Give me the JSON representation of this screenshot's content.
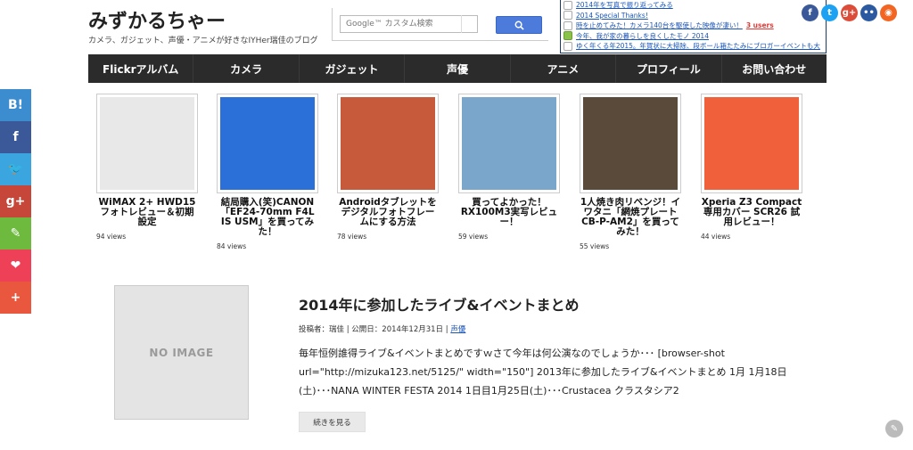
{
  "site": {
    "title": "みずかるちゃー",
    "description": "カメラ、ガジェット、声優・アニメが好きなIYHer瑞佳のブログ"
  },
  "search": {
    "placeholder": "Google™ カスタム検索"
  },
  "hatena": {
    "items": [
      {
        "text": "2014年を写真で振り返ってみる",
        "users": ""
      },
      {
        "text": "2014 Special Thanks!",
        "users": ""
      },
      {
        "text": "時を止めてみた！カメラ140台を駆使した映像が凄い！",
        "users": "3 users"
      },
      {
        "text": "今年、我が家の暮らしを良くしたモノ 2014",
        "users": ""
      },
      {
        "text": "ゆく年くる年2015。年賀状に大掃除、段ボール箱たたみにブロガーイベントも大",
        "users": ""
      }
    ]
  },
  "social_top": [
    {
      "icon": "facebook-icon",
      "glyph": "f",
      "color": "#3b5998"
    },
    {
      "icon": "twitter-icon",
      "glyph": "t",
      "color": "#1da1f2"
    },
    {
      "icon": "googleplus-icon",
      "glyph": "g+",
      "color": "#dd4b39"
    },
    {
      "icon": "flickr-icon",
      "glyph": "••",
      "color": "#2c5aa0"
    },
    {
      "icon": "rss-icon",
      "glyph": "◉",
      "color": "#f26522"
    }
  ],
  "nav": [
    "Flickrアルバム",
    "カメラ",
    "ガジェット",
    "声優",
    "アニメ",
    "プロフィール",
    "お問い合わせ"
  ],
  "share_bar": [
    {
      "icon": "hatena-bookmark-icon",
      "glyph": "B!",
      "color": "#3c8cd0"
    },
    {
      "icon": "facebook-icon",
      "glyph": "f",
      "color": "#3b5998"
    },
    {
      "icon": "twitter-icon",
      "glyph": "🐦",
      "color": "#3ba5e0"
    },
    {
      "icon": "googleplus-icon",
      "glyph": "g+",
      "color": "#c6473a"
    },
    {
      "icon": "evernote-icon",
      "glyph": "✎",
      "color": "#6dba3f"
    },
    {
      "icon": "pocket-icon",
      "glyph": "❤",
      "color": "#ee4056"
    },
    {
      "icon": "more-share-icon",
      "glyph": "+",
      "color": "#e9573f"
    }
  ],
  "popular": [
    {
      "title": "WiMAX 2+ HWD15 フォトレビュー＆初期設定",
      "views": "94 views",
      "thumb_color": "#e8e8e8"
    },
    {
      "title": "結局購入(笑)CANON「EF24-70mm F4L IS USM」を買ってみた！",
      "views": "84 views",
      "thumb_color": "#2b6fd8"
    },
    {
      "title": "Androidタブレットをデジタルフォトフレームにする方法",
      "views": "78 views",
      "thumb_color": "#c65a3a"
    },
    {
      "title": "買ってよかった！RX100M3実写レビュー！",
      "views": "59 views",
      "thumb_color": "#7aa6cc"
    },
    {
      "title": "1人焼き肉リベンジ！イワタニ「網焼プレート CB-P-AM2」を買ってみた！",
      "views": "55 views",
      "thumb_color": "#5a4a3a"
    },
    {
      "title": "Xperia Z3 Compact専用カバー SCR26 試用レビュー！",
      "views": "44 views",
      "thumb_color": "#f0603a"
    }
  ],
  "article": {
    "no_image": "NO IMAGE",
    "title": "2014年に参加したライブ&イベントまとめ",
    "meta_author": "投稿者：瑞佳",
    "meta_sep": " | ",
    "meta_date": "公開日：2014年12月31日",
    "meta_sep2": " | ",
    "category": "声優",
    "excerpt": "毎年恒例誰得ライブ&イベントまとめですｗさて今年は何公演なのでしょうか･･･ [browser-shot url=\"http://mizuka123.net/5125/\" width=\"150\"] 2013年に参加したライブ&イベントまとめ 1月 1月18日(土)･･･NANA WINTER FESTA 2014 1日目1月25日(土)･･･Crustacea クラスタシア2",
    "read_more": "続きを見る"
  }
}
